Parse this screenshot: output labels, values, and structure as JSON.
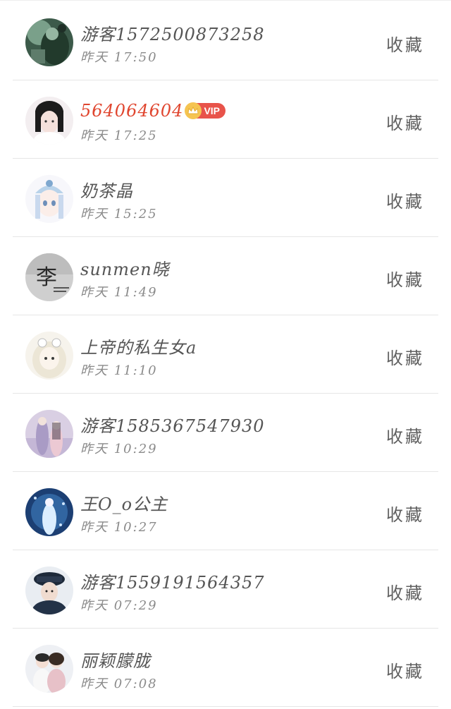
{
  "list": {
    "items": [
      {
        "name": "游客1572500873258",
        "time": "昨天 17:50",
        "action": "收藏",
        "vip": false,
        "avatar": "dark-green-figure"
      },
      {
        "name": "564064604",
        "time": "昨天 17:25",
        "action": "收藏",
        "vip": true,
        "vip_label": "VIP",
        "avatar": "girl-black-hair"
      },
      {
        "name": "奶茶晶",
        "time": "昨天 15:25",
        "action": "收藏",
        "vip": false,
        "avatar": "anime-girl-headdress"
      },
      {
        "name": "sunmen晓",
        "time": "昨天 11:49",
        "action": "收藏",
        "vip": false,
        "avatar": "li-character",
        "avatar_text": "李"
      },
      {
        "name": "上帝的私生女a",
        "time": "昨天 11:10",
        "action": "收藏",
        "vip": false,
        "avatar": "white-hair-girl"
      },
      {
        "name": "游客1585367547930",
        "time": "昨天 10:29",
        "action": "收藏",
        "vip": false,
        "avatar": "couple-purple"
      },
      {
        "name": "王O_o公主",
        "time": "昨天 10:27",
        "action": "收藏",
        "vip": false,
        "avatar": "blue-fantasy-girl"
      },
      {
        "name": "游客1559191564357",
        "time": "昨天 07:29",
        "action": "收藏",
        "vip": false,
        "avatar": "boy-cap-dark"
      },
      {
        "name": "丽颖朦胧",
        "time": "昨天 07:08",
        "action": "收藏",
        "vip": false,
        "avatar": "couple-photo"
      }
    ]
  },
  "colors": {
    "name": "#555555",
    "vip_name": "#e0462f",
    "time": "#8a8a8a",
    "action": "#606060",
    "vip_badge": "#e8534a",
    "vip_crown": "#f5c451",
    "divider": "#e6e6e6"
  }
}
